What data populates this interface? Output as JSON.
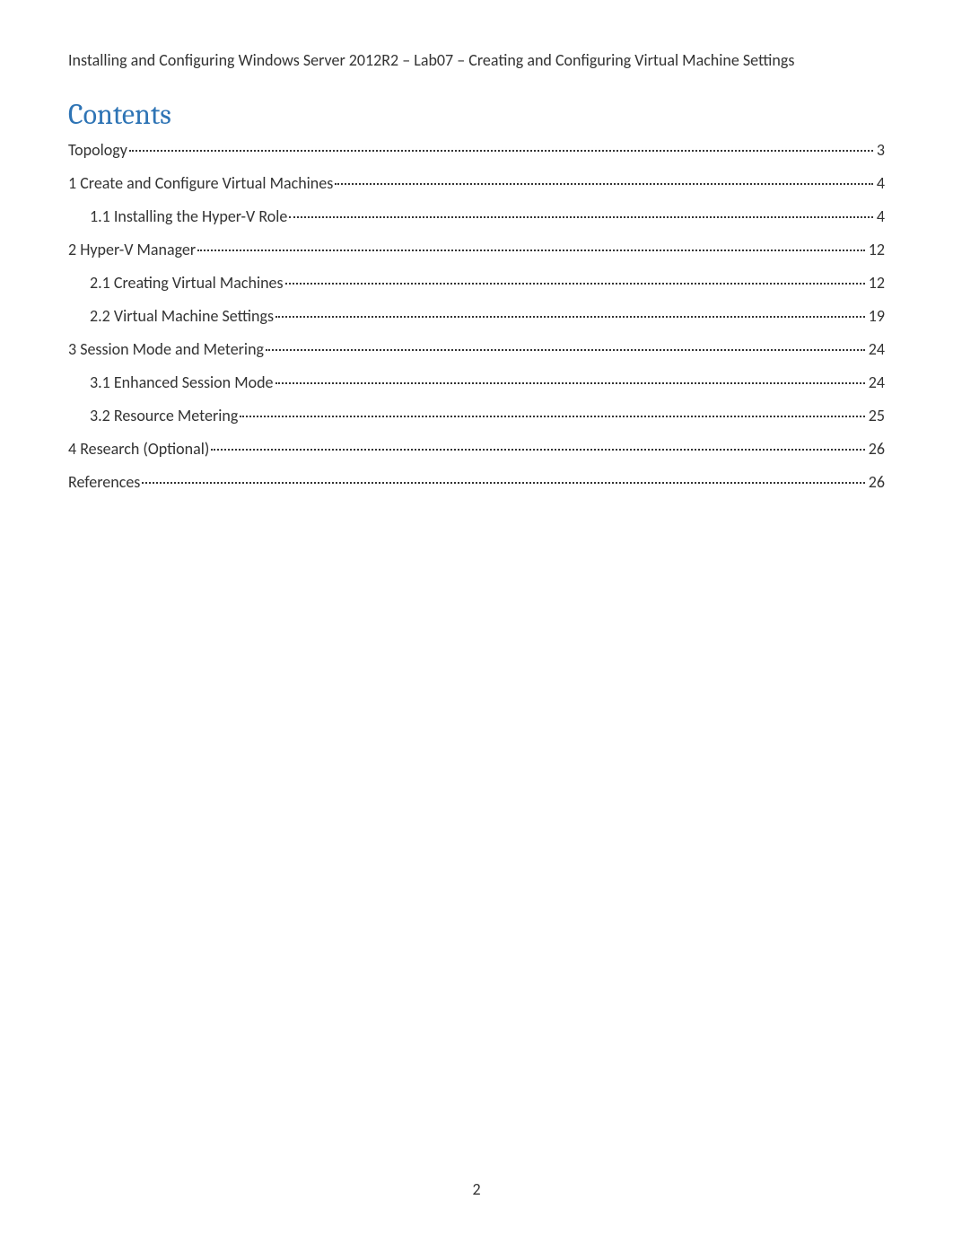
{
  "header": {
    "text": "Installing and Configuring Windows Server 2012R2 – Lab07 – Creating and Configuring Virtual Machine Settings"
  },
  "contents": {
    "heading": "Contents",
    "entries": [
      {
        "title": "Topology",
        "page": "3",
        "level": 1
      },
      {
        "title": "1 Create and Configure Virtual Machines",
        "page": "4",
        "level": 1
      },
      {
        "title": "1.1 Installing the Hyper-V Role",
        "page": "4",
        "level": 2
      },
      {
        "title": "2 Hyper-V Manager",
        "page": "12",
        "level": 1
      },
      {
        "title": "2.1 Creating Virtual Machines",
        "page": "12",
        "level": 2
      },
      {
        "title": "2.2 Virtual Machine Settings",
        "page": "19",
        "level": 2
      },
      {
        "title": "3 Session Mode and Metering",
        "page": "24",
        "level": 1
      },
      {
        "title": "3.1 Enhanced Session Mode",
        "page": "24",
        "level": 2
      },
      {
        "title": "3.2 Resource Metering",
        "page": "25",
        "level": 2
      },
      {
        "title": "4 Research (Optional)",
        "page": "26",
        "level": 1
      },
      {
        "title": "References",
        "page": "26",
        "level": 1
      }
    ]
  },
  "footer": {
    "page_number": "2"
  }
}
